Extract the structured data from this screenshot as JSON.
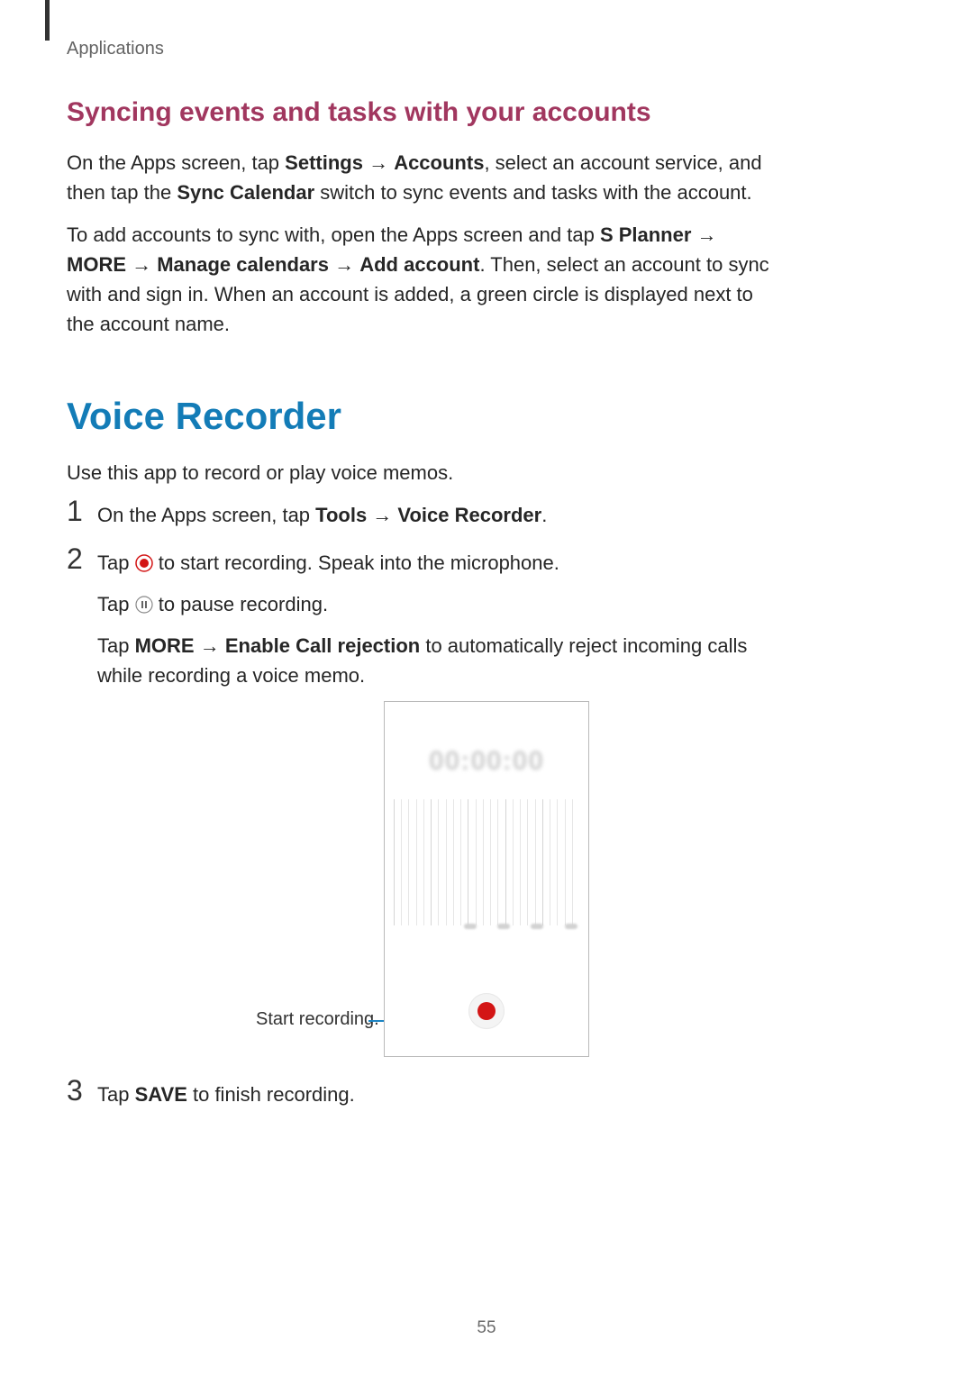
{
  "header": {
    "running": "Applications"
  },
  "sync": {
    "heading": "Syncing events and tasks with your accounts",
    "p1": {
      "t1": "On the Apps screen, tap ",
      "b1": "Settings",
      "arrow1": " → ",
      "b2": "Accounts",
      "t2": ", select an account service, and then tap the ",
      "b3": "Sync Calendar",
      "t3": " switch to sync events and tasks with the account."
    },
    "p2": {
      "t1": "To add accounts to sync with, open the Apps screen and tap ",
      "b1": "S Planner",
      "arrow1": " → ",
      "b2": "MORE",
      "arrow2": " → ",
      "b3": "Manage calendars",
      "arrow3": " → ",
      "b4": "Add account",
      "t2": ". Then, select an account to sync with and sign in. When an account is added, a green circle is displayed next to the account name."
    }
  },
  "recorder": {
    "title": "Voice Recorder",
    "intro": "Use this app to record or play voice memos.",
    "step1": {
      "num": "1",
      "t1": "On the Apps screen, tap ",
      "b1": "Tools",
      "arrow1": " → ",
      "b2": "Voice Recorder",
      "t2": "."
    },
    "step2": {
      "num": "2",
      "l1a": "Tap ",
      "l1b": " to start recording. Speak into the microphone.",
      "l2a": "Tap ",
      "l2b": " to pause recording.",
      "l3a": "Tap ",
      "b1": "MORE",
      "arrow1": " → ",
      "b2": "Enable Call rejection",
      "l3b": " to automatically reject incoming calls while recording a voice memo."
    },
    "step3": {
      "num": "3",
      "t1": "Tap ",
      "b1": "SAVE",
      "t2": " to finish recording."
    }
  },
  "figure": {
    "callout": "Start recording.",
    "timer": "00:00:00"
  },
  "page": {
    "num": "55"
  }
}
